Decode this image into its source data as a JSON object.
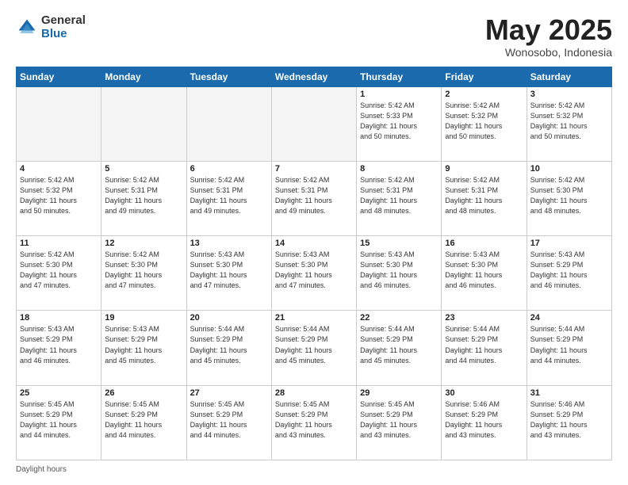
{
  "logo": {
    "general": "General",
    "blue": "Blue"
  },
  "title": "May 2025",
  "subtitle": "Wonosobo, Indonesia",
  "days_of_week": [
    "Sunday",
    "Monday",
    "Tuesday",
    "Wednesday",
    "Thursday",
    "Friday",
    "Saturday"
  ],
  "footer": "Daylight hours",
  "weeks": [
    [
      {
        "day": "",
        "info": ""
      },
      {
        "day": "",
        "info": ""
      },
      {
        "day": "",
        "info": ""
      },
      {
        "day": "",
        "info": ""
      },
      {
        "day": "1",
        "info": "Sunrise: 5:42 AM\nSunset: 5:33 PM\nDaylight: 11 hours\nand 50 minutes."
      },
      {
        "day": "2",
        "info": "Sunrise: 5:42 AM\nSunset: 5:32 PM\nDaylight: 11 hours\nand 50 minutes."
      },
      {
        "day": "3",
        "info": "Sunrise: 5:42 AM\nSunset: 5:32 PM\nDaylight: 11 hours\nand 50 minutes."
      }
    ],
    [
      {
        "day": "4",
        "info": "Sunrise: 5:42 AM\nSunset: 5:32 PM\nDaylight: 11 hours\nand 50 minutes."
      },
      {
        "day": "5",
        "info": "Sunrise: 5:42 AM\nSunset: 5:31 PM\nDaylight: 11 hours\nand 49 minutes."
      },
      {
        "day": "6",
        "info": "Sunrise: 5:42 AM\nSunset: 5:31 PM\nDaylight: 11 hours\nand 49 minutes."
      },
      {
        "day": "7",
        "info": "Sunrise: 5:42 AM\nSunset: 5:31 PM\nDaylight: 11 hours\nand 49 minutes."
      },
      {
        "day": "8",
        "info": "Sunrise: 5:42 AM\nSunset: 5:31 PM\nDaylight: 11 hours\nand 48 minutes."
      },
      {
        "day": "9",
        "info": "Sunrise: 5:42 AM\nSunset: 5:31 PM\nDaylight: 11 hours\nand 48 minutes."
      },
      {
        "day": "10",
        "info": "Sunrise: 5:42 AM\nSunset: 5:30 PM\nDaylight: 11 hours\nand 48 minutes."
      }
    ],
    [
      {
        "day": "11",
        "info": "Sunrise: 5:42 AM\nSunset: 5:30 PM\nDaylight: 11 hours\nand 47 minutes."
      },
      {
        "day": "12",
        "info": "Sunrise: 5:42 AM\nSunset: 5:30 PM\nDaylight: 11 hours\nand 47 minutes."
      },
      {
        "day": "13",
        "info": "Sunrise: 5:43 AM\nSunset: 5:30 PM\nDaylight: 11 hours\nand 47 minutes."
      },
      {
        "day": "14",
        "info": "Sunrise: 5:43 AM\nSunset: 5:30 PM\nDaylight: 11 hours\nand 47 minutes."
      },
      {
        "day": "15",
        "info": "Sunrise: 5:43 AM\nSunset: 5:30 PM\nDaylight: 11 hours\nand 46 minutes."
      },
      {
        "day": "16",
        "info": "Sunrise: 5:43 AM\nSunset: 5:30 PM\nDaylight: 11 hours\nand 46 minutes."
      },
      {
        "day": "17",
        "info": "Sunrise: 5:43 AM\nSunset: 5:29 PM\nDaylight: 11 hours\nand 46 minutes."
      }
    ],
    [
      {
        "day": "18",
        "info": "Sunrise: 5:43 AM\nSunset: 5:29 PM\nDaylight: 11 hours\nand 46 minutes."
      },
      {
        "day": "19",
        "info": "Sunrise: 5:43 AM\nSunset: 5:29 PM\nDaylight: 11 hours\nand 45 minutes."
      },
      {
        "day": "20",
        "info": "Sunrise: 5:44 AM\nSunset: 5:29 PM\nDaylight: 11 hours\nand 45 minutes."
      },
      {
        "day": "21",
        "info": "Sunrise: 5:44 AM\nSunset: 5:29 PM\nDaylight: 11 hours\nand 45 minutes."
      },
      {
        "day": "22",
        "info": "Sunrise: 5:44 AM\nSunset: 5:29 PM\nDaylight: 11 hours\nand 45 minutes."
      },
      {
        "day": "23",
        "info": "Sunrise: 5:44 AM\nSunset: 5:29 PM\nDaylight: 11 hours\nand 44 minutes."
      },
      {
        "day": "24",
        "info": "Sunrise: 5:44 AM\nSunset: 5:29 PM\nDaylight: 11 hours\nand 44 minutes."
      }
    ],
    [
      {
        "day": "25",
        "info": "Sunrise: 5:45 AM\nSunset: 5:29 PM\nDaylight: 11 hours\nand 44 minutes."
      },
      {
        "day": "26",
        "info": "Sunrise: 5:45 AM\nSunset: 5:29 PM\nDaylight: 11 hours\nand 44 minutes."
      },
      {
        "day": "27",
        "info": "Sunrise: 5:45 AM\nSunset: 5:29 PM\nDaylight: 11 hours\nand 44 minutes."
      },
      {
        "day": "28",
        "info": "Sunrise: 5:45 AM\nSunset: 5:29 PM\nDaylight: 11 hours\nand 43 minutes."
      },
      {
        "day": "29",
        "info": "Sunrise: 5:45 AM\nSunset: 5:29 PM\nDaylight: 11 hours\nand 43 minutes."
      },
      {
        "day": "30",
        "info": "Sunrise: 5:46 AM\nSunset: 5:29 PM\nDaylight: 11 hours\nand 43 minutes."
      },
      {
        "day": "31",
        "info": "Sunrise: 5:46 AM\nSunset: 5:29 PM\nDaylight: 11 hours\nand 43 minutes."
      }
    ]
  ]
}
